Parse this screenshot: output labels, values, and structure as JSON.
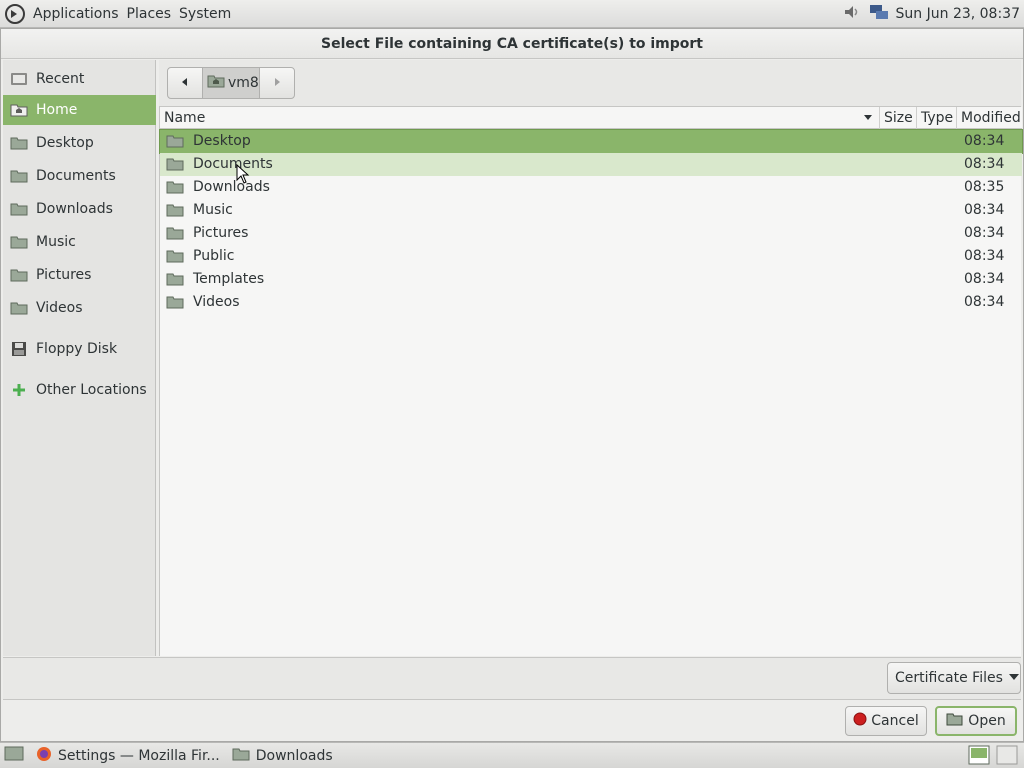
{
  "top_panel": {
    "menu": [
      "Applications",
      "Places",
      "System"
    ],
    "clock": "Sun Jun 23, 08:37"
  },
  "dialog": {
    "title": "Select File containing CA certificate(s) to import",
    "sidebar": [
      {
        "label": "Recent",
        "icon": "recent-icon"
      },
      {
        "label": "Home",
        "icon": "home-icon",
        "selected": true
      },
      {
        "label": "Desktop",
        "icon": "folder-icon"
      },
      {
        "label": "Documents",
        "icon": "folder-icon"
      },
      {
        "label": "Downloads",
        "icon": "folder-icon"
      },
      {
        "label": "Music",
        "icon": "folder-icon"
      },
      {
        "label": "Pictures",
        "icon": "folder-icon"
      },
      {
        "label": "Videos",
        "icon": "folder-icon"
      },
      {
        "label": "Floppy Disk",
        "icon": "floppy-icon"
      },
      {
        "label": "Other Locations",
        "icon": "plus-icon"
      }
    ],
    "pathbar": {
      "current": "vm8"
    },
    "columns": {
      "name": "Name",
      "size": "Size",
      "type": "Type",
      "modified": "Modified"
    },
    "files": [
      {
        "name": "Desktop",
        "modified": "08:34",
        "selected": true
      },
      {
        "name": "Documents",
        "modified": "08:34",
        "hover": true
      },
      {
        "name": "Downloads",
        "modified": "08:35"
      },
      {
        "name": "Music",
        "modified": "08:34"
      },
      {
        "name": "Pictures",
        "modified": "08:34"
      },
      {
        "name": "Public",
        "modified": "08:34"
      },
      {
        "name": "Templates",
        "modified": "08:34"
      },
      {
        "name": "Videos",
        "modified": "08:34"
      }
    ],
    "filter": "Certificate Files",
    "cancel_label": "Cancel",
    "open_label": "Open"
  },
  "taskbar": {
    "tasks": [
      "Settings — Mozilla Fir...",
      "Downloads"
    ]
  },
  "colors": {
    "accent": "#8ab56a",
    "hover": "#d9e8cc"
  }
}
